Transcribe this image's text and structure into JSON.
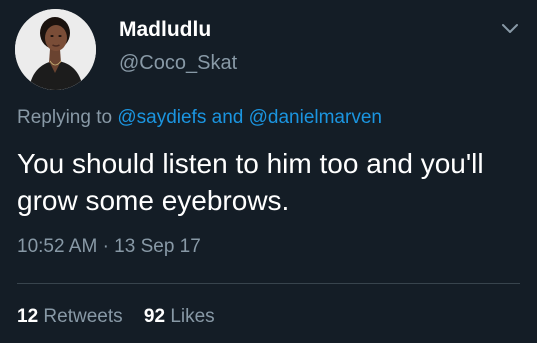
{
  "theme": {
    "background": "#141d26",
    "text_primary": "#ffffff",
    "text_secondary": "#8899a6",
    "link": "#1b95e0",
    "divider": "#38444d"
  },
  "author": {
    "display_name": "Madludlu",
    "handle": "@Coco_Skat",
    "avatar_icon": "profile-photo"
  },
  "menu": {
    "icon": "chevron-down-icon"
  },
  "reply": {
    "prefix": "Replying to",
    "mentions": [
      "@saydiefs",
      "@danielmarven"
    ],
    "joiner": "and"
  },
  "tweet": {
    "text": "You should listen to him too and you'll grow some eyebrows.",
    "time": "10:52 AM",
    "separator": "·",
    "date": "13 Sep 17"
  },
  "stats": {
    "retweets_count": "12",
    "retweets_label": "Retweets",
    "likes_count": "92",
    "likes_label": "Likes"
  }
}
